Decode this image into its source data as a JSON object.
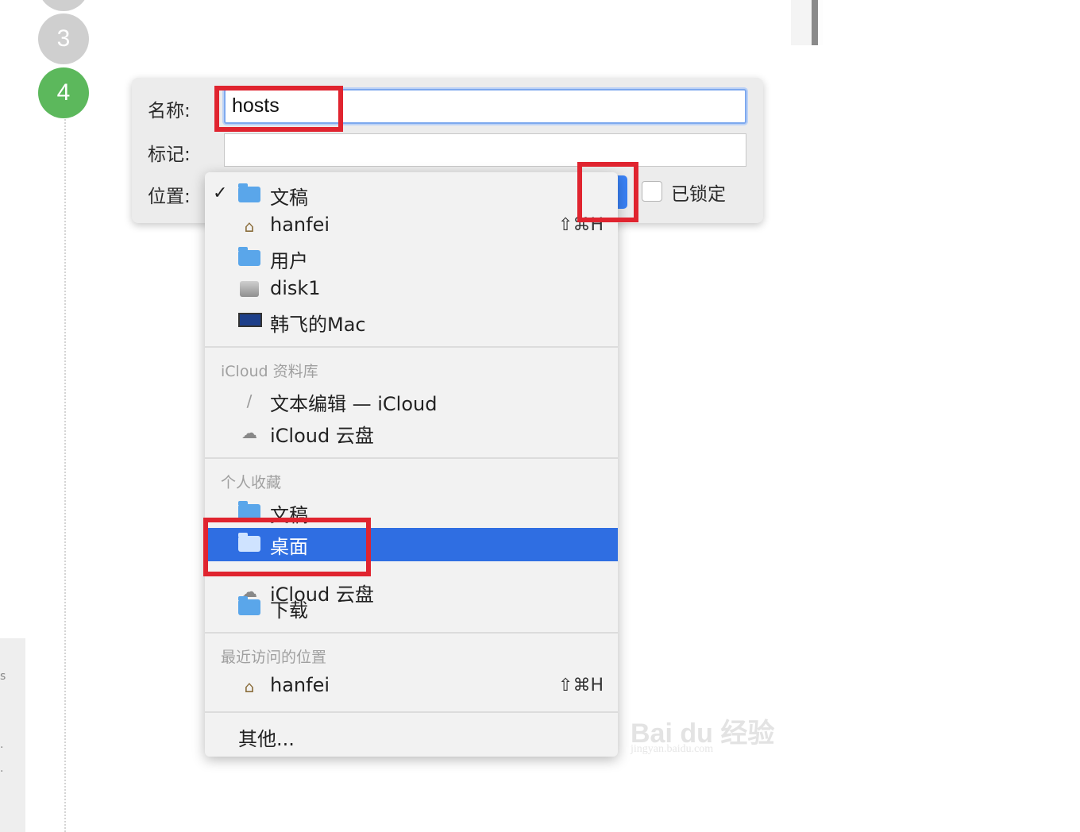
{
  "steps": {
    "prev": "",
    "three": "3",
    "four": "4"
  },
  "left_panel": {
    "chars": [
      "s",
      "·",
      "·"
    ]
  },
  "dialog": {
    "name_label": "名称:",
    "name_value": "hosts",
    "tags_label": "标记:",
    "location_label": "位置:",
    "locked_label": "已锁定",
    "accent_color": "#3a82f6"
  },
  "menu": {
    "top_items": [
      {
        "label": "文稿",
        "icon": "folder-icon",
        "checked": true,
        "check": "✓"
      },
      {
        "label": "hanfei",
        "icon": "home-icon",
        "shortcut": "⇧⌘H"
      },
      {
        "label": "用户",
        "icon": "users-folder-icon"
      },
      {
        "label": "disk1",
        "icon": "disk-icon"
      },
      {
        "label": "韩飞的Mac",
        "icon": "computer-icon"
      }
    ],
    "icloud_section": "iCloud 资料库",
    "icloud_items": [
      {
        "label": "文本编辑 — iCloud",
        "icon": "textedit-icon"
      },
      {
        "label": "iCloud 云盘",
        "icon": "cloud-icon"
      }
    ],
    "favorites_section": "个人收藏",
    "favorites_items": [
      {
        "label": "文稿",
        "icon": "folder-icon"
      },
      {
        "label": "桌面",
        "icon": "desktop-folder-icon",
        "selected": true
      },
      {
        "label": "iCloud 云盘",
        "icon": "cloud-icon"
      },
      {
        "label": "下载",
        "icon": "downloads-folder-icon"
      }
    ],
    "recent_section": "最近访问的位置",
    "recent_items": [
      {
        "label": "hanfei",
        "icon": "home-icon",
        "shortcut": "⇧⌘H"
      }
    ],
    "other_label": "其他...",
    "selected_color": "#2f6ee2"
  },
  "annotation_color": "#e0242f",
  "watermark": {
    "logo": "Bai du 经验",
    "url": "jingyan.baidu.com"
  }
}
